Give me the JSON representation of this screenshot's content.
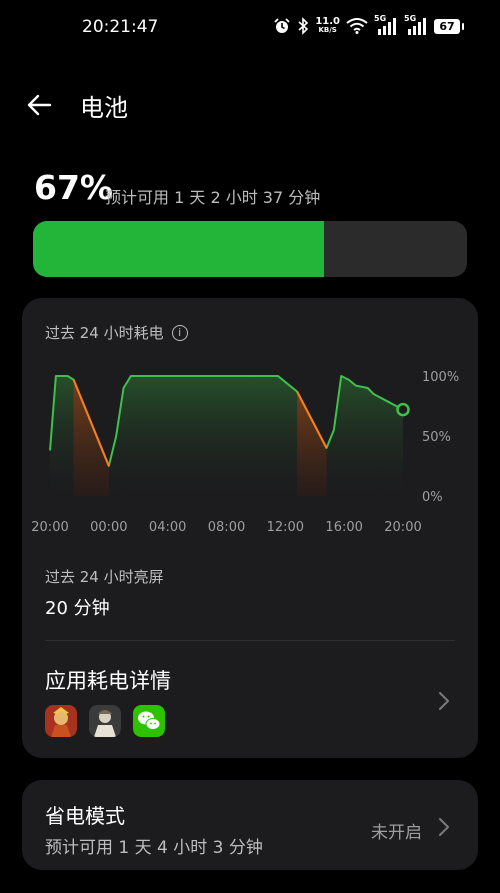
{
  "status_bar": {
    "time": "20:21:47",
    "net_speed_value": "11.0",
    "net_speed_unit": "KB/S",
    "signal_label_1": "5G",
    "signal_label_2": "5G",
    "battery_level": "67"
  },
  "header": {
    "title": "电池"
  },
  "battery": {
    "percent_label": "67%",
    "percent_value": 67,
    "estimate": "预计可用 1 天 2 小时 37 分钟",
    "fill_color": "#22b53a"
  },
  "usage_card": {
    "title": "过去 24 小时耗电",
    "screen_on_label": "过去 24 小时亮屏",
    "screen_on_value": "20 分钟",
    "apps_title": "应用耗电详情",
    "apps": [
      "王者荣耀",
      "和平精英",
      "微信"
    ]
  },
  "chart_data": {
    "type": "area",
    "title": "过去 24 小时耗电",
    "x_tick_labels": [
      "20:00",
      "00:00",
      "04:00",
      "08:00",
      "12:00",
      "16:00",
      "20:00"
    ],
    "y_tick_labels": [
      "100%",
      "50%",
      "0%"
    ],
    "ylim": [
      0,
      100
    ],
    "x_unit": "hours since 20:00",
    "xlim": [
      0,
      24
    ],
    "series": [
      {
        "type": "battery-level",
        "color": "#3ec14a",
        "points": [
          [
            0,
            38
          ],
          [
            0.4,
            100
          ],
          [
            1.2,
            100
          ],
          [
            1.6,
            97
          ],
          [
            4.0,
            25
          ],
          [
            4.5,
            50
          ],
          [
            5.0,
            90
          ],
          [
            5.5,
            100
          ],
          [
            15.5,
            100
          ],
          [
            16.8,
            87
          ],
          [
            18.8,
            40
          ],
          [
            19.3,
            55
          ],
          [
            19.8,
            100
          ],
          [
            20.3,
            97
          ],
          [
            20.8,
            92
          ],
          [
            21.6,
            90
          ],
          [
            22.0,
            85
          ],
          [
            24.0,
            72
          ]
        ]
      }
    ],
    "charging_segments": [
      [
        1.6,
        4.0
      ],
      [
        16.8,
        18.8
      ]
    ],
    "charging_color": "#ff7a1a",
    "grid": false,
    "legend": "none"
  },
  "power_saving": {
    "title": "省电模式",
    "estimate": "预计可用 1 天 4 小时 3 分钟",
    "status": "未开启"
  }
}
